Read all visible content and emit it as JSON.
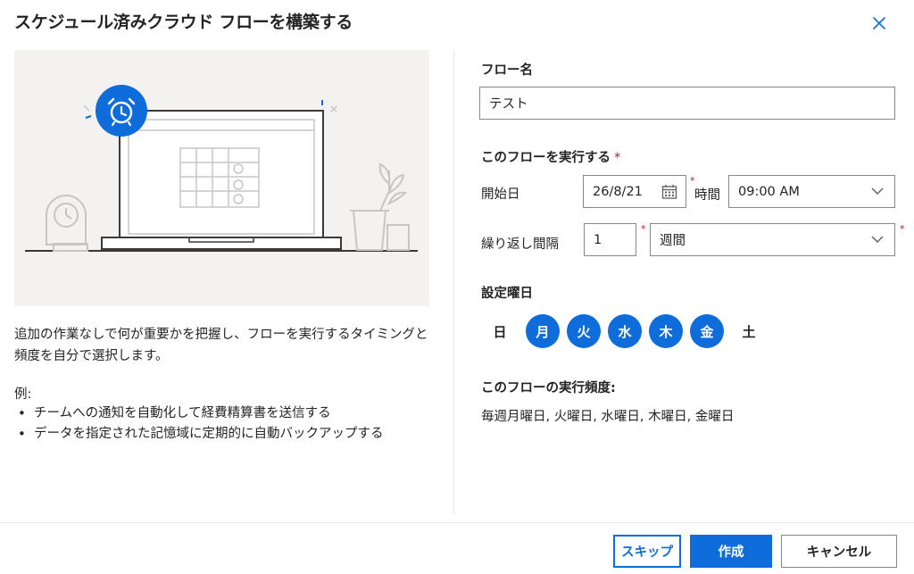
{
  "dialog": {
    "title": "スケジュール済みクラウド フローを構築する"
  },
  "left": {
    "description": "追加の作業なしで何が重要かを把握し、フローを実行するタイミングと頻度を自分で選択します。",
    "example_label": "例:",
    "examples": [
      "チームへの通知を自動化して経費精算書を送信する",
      "データを指定された記憶域に定期的に自動バックアップする"
    ]
  },
  "form": {
    "flow_name_label": "フロー名",
    "flow_name_value": "テスト",
    "run_label": "このフローを実行する",
    "required_mark": "*",
    "start_date_label": "開始日",
    "start_date_value": "26/8/21",
    "time_label": "時間",
    "time_value": "09:00 AM",
    "repeat_label": "繰り返し間隔",
    "repeat_count": "1",
    "repeat_unit": "週間",
    "weekday_label": "設定曜日",
    "weekdays": [
      {
        "label": "日",
        "selected": false
      },
      {
        "label": "月",
        "selected": true
      },
      {
        "label": "火",
        "selected": true
      },
      {
        "label": "水",
        "selected": true
      },
      {
        "label": "木",
        "selected": true
      },
      {
        "label": "金",
        "selected": true
      },
      {
        "label": "土",
        "selected": false
      }
    ],
    "frequency_label": "このフローの実行頻度:",
    "frequency_text": "毎週月曜日, 火曜日, 水曜日, 木曜日, 金曜日"
  },
  "footer": {
    "skip_label": "スキップ",
    "create_label": "作成",
    "cancel_label": "キャンセル"
  },
  "colors": {
    "accent": "#0f6cdb",
    "required": "#a4262c",
    "illustration_bg": "#f3f2f1"
  },
  "icons": {
    "close": "close-icon",
    "calendar": "calendar-icon",
    "chevron": "chevron-down-icon",
    "alarm": "alarm-clock-icon"
  }
}
